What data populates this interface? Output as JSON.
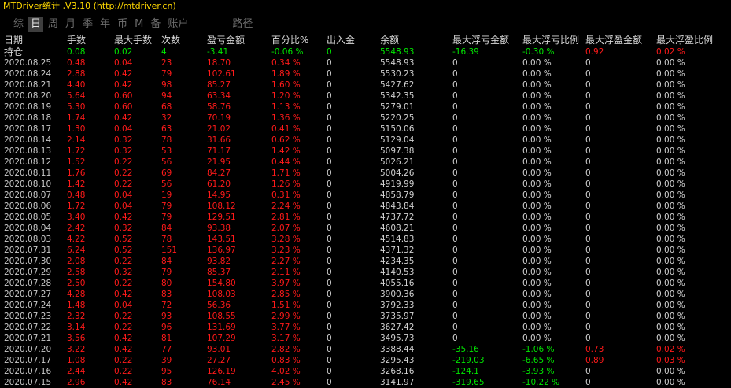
{
  "window": {
    "title": "MTDriver统计 ,V3.10 (http://mtdriver.cn)"
  },
  "tabs": [
    {
      "label": "综",
      "selected": false
    },
    {
      "label": "日",
      "selected": true
    },
    {
      "label": "周",
      "selected": false
    },
    {
      "label": "月",
      "selected": false
    },
    {
      "label": "季",
      "selected": false
    },
    {
      "label": "年",
      "selected": false
    },
    {
      "label": "币",
      "selected": false
    },
    {
      "label": "M",
      "selected": false
    },
    {
      "label": "备",
      "selected": false
    },
    {
      "label": "账户",
      "selected": false
    },
    {
      "label": "路径",
      "selected": false
    }
  ],
  "colors": {
    "title": "#ffd800",
    "green": "#00e400",
    "red": "#ff1a1a",
    "tab_selected_bg": "#3e3e3e"
  },
  "table": {
    "headers": [
      "日期",
      "手数",
      "最大手数",
      "次数",
      "盈亏金额",
      "百分比%",
      "出入金",
      "余额",
      "最大浮亏金额",
      "最大浮亏比例",
      "最大浮盈金额",
      "最大浮盈比例"
    ],
    "holding": [
      "持仓",
      "0.08",
      "0.02",
      "4",
      "-3.41",
      "-0.06 %",
      "0",
      "5548.93",
      "-16.39",
      "-0.30 %",
      "0.92",
      "0.02 %"
    ],
    "rows": [
      [
        "2020.08.25",
        "0.48",
        "0.04",
        "23",
        "18.70",
        "0.34 %",
        "0",
        "5548.93",
        "0",
        "0.00 %",
        "0",
        "0.00 %"
      ],
      [
        "2020.08.24",
        "2.88",
        "0.42",
        "79",
        "102.61",
        "1.89 %",
        "0",
        "5530.23",
        "0",
        "0.00 %",
        "0",
        "0.00 %"
      ],
      [
        "2020.08.21",
        "4.40",
        "0.42",
        "98",
        "85.27",
        "1.60 %",
        "0",
        "5427.62",
        "0",
        "0.00 %",
        "0",
        "0.00 %"
      ],
      [
        "2020.08.20",
        "5.64",
        "0.60",
        "94",
        "63.34",
        "1.20 %",
        "0",
        "5342.35",
        "0",
        "0.00 %",
        "0",
        "0.00 %"
      ],
      [
        "2020.08.19",
        "5.30",
        "0.60",
        "68",
        "58.76",
        "1.13 %",
        "0",
        "5279.01",
        "0",
        "0.00 %",
        "0",
        "0.00 %"
      ],
      [
        "2020.08.18",
        "1.74",
        "0.42",
        "32",
        "70.19",
        "1.36 %",
        "0",
        "5220.25",
        "0",
        "0.00 %",
        "0",
        "0.00 %"
      ],
      [
        "2020.08.17",
        "1.30",
        "0.04",
        "63",
        "21.02",
        "0.41 %",
        "0",
        "5150.06",
        "0",
        "0.00 %",
        "0",
        "0.00 %"
      ],
      [
        "2020.08.14",
        "2.14",
        "0.32",
        "78",
        "31.66",
        "0.62 %",
        "0",
        "5129.04",
        "0",
        "0.00 %",
        "0",
        "0.00 %"
      ],
      [
        "2020.08.13",
        "1.72",
        "0.32",
        "53",
        "71.17",
        "1.42 %",
        "0",
        "5097.38",
        "0",
        "0.00 %",
        "0",
        "0.00 %"
      ],
      [
        "2020.08.12",
        "1.52",
        "0.22",
        "56",
        "21.95",
        "0.44 %",
        "0",
        "5026.21",
        "0",
        "0.00 %",
        "0",
        "0.00 %"
      ],
      [
        "2020.08.11",
        "1.76",
        "0.22",
        "69",
        "84.27",
        "1.71 %",
        "0",
        "5004.26",
        "0",
        "0.00 %",
        "0",
        "0.00 %"
      ],
      [
        "2020.08.10",
        "1.42",
        "0.22",
        "56",
        "61.20",
        "1.26 %",
        "0",
        "4919.99",
        "0",
        "0.00 %",
        "0",
        "0.00 %"
      ],
      [
        "2020.08.07",
        "0.48",
        "0.04",
        "19",
        "14.95",
        "0.31 %",
        "0",
        "4858.79",
        "0",
        "0.00 %",
        "0",
        "0.00 %"
      ],
      [
        "2020.08.06",
        "1.72",
        "0.04",
        "79",
        "108.12",
        "2.24 %",
        "0",
        "4843.84",
        "0",
        "0.00 %",
        "0",
        "0.00 %"
      ],
      [
        "2020.08.05",
        "3.40",
        "0.42",
        "79",
        "129.51",
        "2.81 %",
        "0",
        "4737.72",
        "0",
        "0.00 %",
        "0",
        "0.00 %"
      ],
      [
        "2020.08.04",
        "2.42",
        "0.32",
        "84",
        "93.38",
        "2.07 %",
        "0",
        "4608.21",
        "0",
        "0.00 %",
        "0",
        "0.00 %"
      ],
      [
        "2020.08.03",
        "4.22",
        "0.52",
        "78",
        "143.51",
        "3.28 %",
        "0",
        "4514.83",
        "0",
        "0.00 %",
        "0",
        "0.00 %"
      ],
      [
        "2020.07.31",
        "6.24",
        "0.52",
        "151",
        "136.97",
        "3.23 %",
        "0",
        "4371.32",
        "0",
        "0.00 %",
        "0",
        "0.00 %"
      ],
      [
        "2020.07.30",
        "2.08",
        "0.22",
        "84",
        "93.82",
        "2.27 %",
        "0",
        "4234.35",
        "0",
        "0.00 %",
        "0",
        "0.00 %"
      ],
      [
        "2020.07.29",
        "2.58",
        "0.32",
        "79",
        "85.37",
        "2.11 %",
        "0",
        "4140.53",
        "0",
        "0.00 %",
        "0",
        "0.00 %"
      ],
      [
        "2020.07.28",
        "2.50",
        "0.22",
        "80",
        "154.80",
        "3.97 %",
        "0",
        "4055.16",
        "0",
        "0.00 %",
        "0",
        "0.00 %"
      ],
      [
        "2020.07.27",
        "4.28",
        "0.42",
        "83",
        "108.03",
        "2.85 %",
        "0",
        "3900.36",
        "0",
        "0.00 %",
        "0",
        "0.00 %"
      ],
      [
        "2020.07.24",
        "1.48",
        "0.04",
        "72",
        "56.36",
        "1.51 %",
        "0",
        "3792.33",
        "0",
        "0.00 %",
        "0",
        "0.00 %"
      ],
      [
        "2020.07.23",
        "2.32",
        "0.22",
        "93",
        "108.55",
        "2.99 %",
        "0",
        "3735.97",
        "0",
        "0.00 %",
        "0",
        "0.00 %"
      ],
      [
        "2020.07.22",
        "3.14",
        "0.22",
        "96",
        "131.69",
        "3.77 %",
        "0",
        "3627.42",
        "0",
        "0.00 %",
        "0",
        "0.00 %"
      ],
      [
        "2020.07.21",
        "3.56",
        "0.42",
        "81",
        "107.29",
        "3.17 %",
        "0",
        "3495.73",
        "0",
        "0.00 %",
        "0",
        "0.00 %"
      ],
      [
        "2020.07.20",
        "3.22",
        "0.42",
        "77",
        "93.01",
        "2.82 %",
        "0",
        "3388.44",
        "-35.16",
        "-1.06 %",
        "0.73",
        "0.02 %"
      ],
      [
        "2020.07.17",
        "1.08",
        "0.22",
        "39",
        "27.27",
        "0.83 %",
        "0",
        "3295.43",
        "-219.03",
        "-6.65 %",
        "0.89",
        "0.03 %"
      ],
      [
        "2020.07.16",
        "2.44",
        "0.22",
        "95",
        "126.19",
        "4.02 %",
        "0",
        "3268.16",
        "-124.1",
        "-3.93 %",
        "0",
        "0.00 %"
      ],
      [
        "2020.07.15",
        "2.96",
        "0.42",
        "83",
        "76.14",
        "2.45 %",
        "0",
        "3141.97",
        "-319.65",
        "-10.22 %",
        "0",
        "0.00 %"
      ]
    ]
  }
}
